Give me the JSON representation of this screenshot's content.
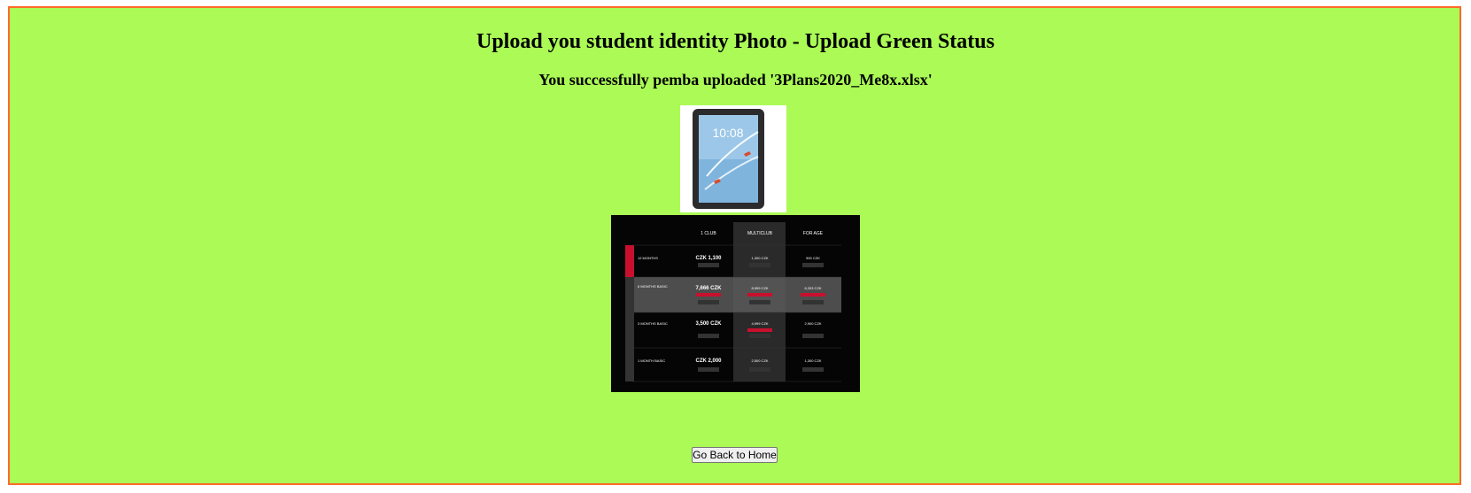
{
  "page": {
    "title": "Upload you student identity Photo - Upload Green Status",
    "message": "You successfully pemba uploaded '3Plans2020_Me8x.xlsx'"
  },
  "images": {
    "tablet": {
      "screen_time": "10:08"
    },
    "plans": {
      "columns": [
        "1 CLUB",
        "MULTICLUB",
        "FOR AGE"
      ],
      "rows": [
        {
          "name": "12 MONTHS",
          "values": [
            "CZK 1,100",
            "1,300 CZK",
            "900 CZK"
          ]
        },
        {
          "name": "6 MONTHS BASIC",
          "values": [
            "7,666 CZK",
            "8,999 CZK",
            "6,333 CZK"
          ]
        },
        {
          "name": "3 MONTHS BASIC",
          "values": [
            "3,500 CZK",
            "4,999 CZK",
            "2,900 CZK"
          ]
        },
        {
          "name": "1 MONTH BASIC",
          "values": [
            "CZK 2,000",
            "2,500 CZK",
            "1,300 CZK"
          ]
        }
      ]
    }
  },
  "actions": {
    "back_label": "Go Back to Home"
  },
  "colors": {
    "panel_bg": "#abfa56",
    "panel_border": "#ff6a2a",
    "accent_red": "#c8102e"
  }
}
